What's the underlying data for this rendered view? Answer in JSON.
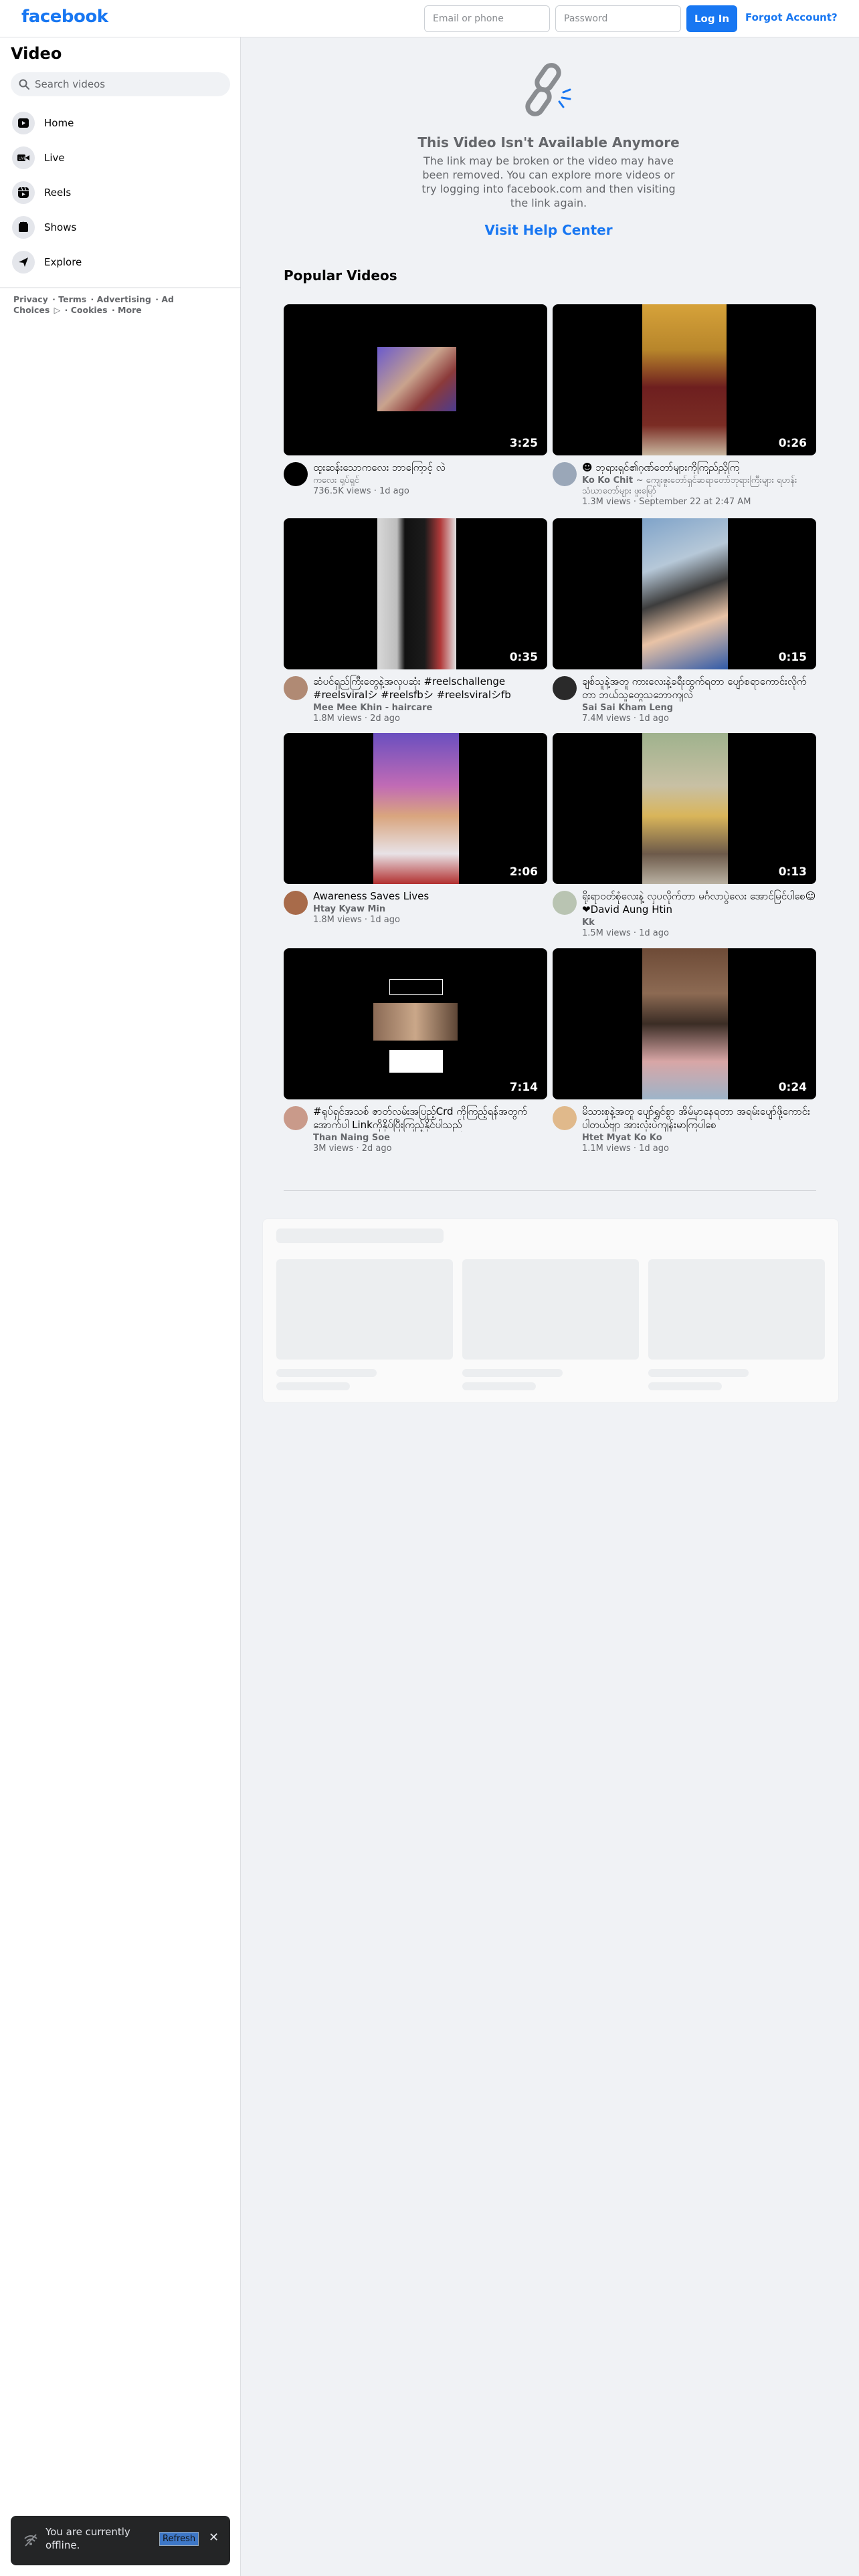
{
  "header": {
    "logo": "facebook",
    "email_placeholder": "Email or phone",
    "password_placeholder": "Password",
    "login_label": "Log In",
    "forgot_label": "Forgot Account?"
  },
  "sidebar": {
    "title": "Video",
    "search_placeholder": "Search videos",
    "items": [
      {
        "label": "Home",
        "icon": "play-icon"
      },
      {
        "label": "Live",
        "icon": "live-camera-icon"
      },
      {
        "label": "Reels",
        "icon": "reels-icon"
      },
      {
        "label": "Shows",
        "icon": "shows-icon"
      },
      {
        "label": "Explore",
        "icon": "explore-icon"
      }
    ],
    "footer_links": [
      "Privacy",
      "Terms",
      "Advertising",
      "Ad Choices",
      "Cookies",
      "More"
    ]
  },
  "unavailable": {
    "title": "This Video Isn't Available Anymore",
    "body": "The link may be broken or the video may have been removed. You can explore more videos or try logging into facebook.com and then visiting the link again.",
    "help_link": "Visit Help Center"
  },
  "popular": {
    "title": "Popular Videos",
    "videos": [
      {
        "title": "ထူးဆန်းသောကလေး ဘာကြောင့် လဲ",
        "author": "ကလေး ရုပ်ရှင်",
        "stats": "736.5K views · 1d ago",
        "duration": "3:25"
      },
      {
        "title": "☻ ဘုရားရှင်၏ဂုဏ်တော်များကိုကြည်ညိုကြ",
        "author": "Ko Ko Chit",
        "extra": "~ ကျေးဇူးတော်ရှင်ဆရာတော်ဘုရားကြီးများ ရဟန်းသံဃာတော်များ ဖူးမြော်",
        "stats": "1.3M views · September 22 at 2:47 AM",
        "duration": "0:26"
      },
      {
        "title": "ဆံပင်ရှည်ကြီးတွေနဲ့အလှပဆုံး #reelschallenge #reelsviralシ #reelsfbシ #reelsviralシfb #hairstyle",
        "author": "Mee Mee Khin - haircare",
        "stats": "1.8M views · 2d ago",
        "duration": "0:35"
      },
      {
        "title": "ချစ်သူနဲ့အတူ ကားလေးနဲ့ခရီးထွက်ရတာ ပျော်စရာကောင်းလိုက်တာ ဘယ်သူတွေသဘောကျလဲ",
        "author": "Sai Sai Kham Leng",
        "stats": "7.4M views · 1d ago",
        "duration": "0:15"
      },
      {
        "title": "Awareness Saves Lives",
        "author": "Htay Kyaw Min",
        "stats": "1.8M views · 1d ago",
        "duration": "2:06"
      },
      {
        "title": "ရိုးရာဝတ်စုံလေးနဲ့ လှပလိုက်တာ မင်္ဂလာပွဲလေး အောင်မြင်ပါစေ☺❤David Aung Htin",
        "author": "Kk",
        "stats": "1.5M views · 1d ago",
        "duration": "0:13"
      },
      {
        "title": "#ရုပ်ရှင်အသစ် ဇာတ်လမ်းအပြည့်Crd ကိုကြည့်ရန်အတွက် အောက်ပါ Linkကိုနှိပ်ပြီးကြည့်နိုင်ပါသည်",
        "author": "Than Naing Soe",
        "stats": "3M views · 2d ago",
        "duration": "7:14"
      },
      {
        "title": "မိသားစုနဲ့အတူ ပျော်ရွှင်စွာ အိမ်မှာနေရတာ အရမ်းပျော်ဖို့ကောင်းပါတယ်ဗျာ အားလုံးပဲကျန်းမာကြပါစေ",
        "author": "Htet Myat Ko Ko",
        "stats": "1.1M views · 1d ago",
        "duration": "0:24"
      }
    ]
  },
  "toast": {
    "message": "You are currently offline.",
    "refresh_label": "Refresh"
  },
  "colors": {
    "brand": "#1877f2",
    "background": "#f0f2f5",
    "toast": "#242526"
  }
}
